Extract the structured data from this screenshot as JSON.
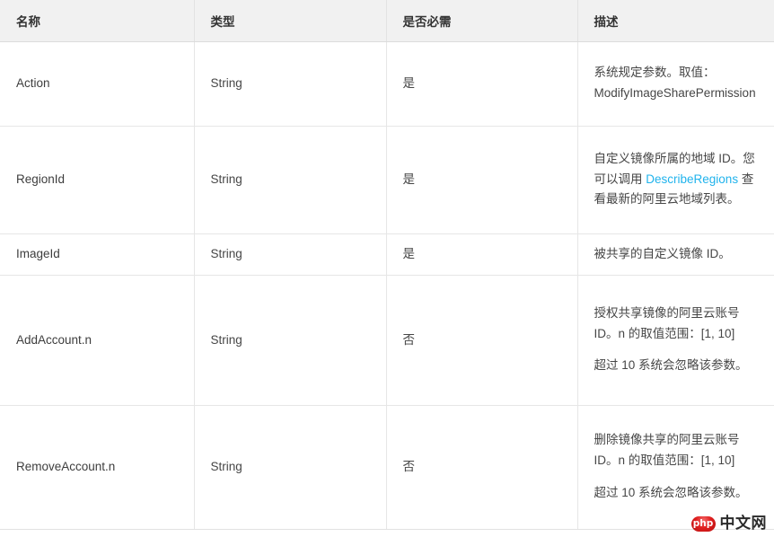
{
  "table": {
    "columns": [
      {
        "key": "name",
        "label": "名称"
      },
      {
        "key": "type",
        "label": "类型"
      },
      {
        "key": "required",
        "label": "是否必需"
      },
      {
        "key": "description",
        "label": "描述"
      }
    ],
    "rows": [
      {
        "name": "Action",
        "type": "String",
        "required": "是",
        "desc_parts": [
          {
            "text": "系统规定参数。取值：ModifyImageSharePermission"
          }
        ]
      },
      {
        "name": "RegionId",
        "type": "String",
        "required": "是",
        "desc_parts": [
          {
            "text_before": "自定义镜像所属的地域 ID。您可以调用 ",
            "link": "DescribeRegions",
            "text_after": " 查看最新的阿里云地域列表。"
          }
        ]
      },
      {
        "name": "ImageId",
        "type": "String",
        "required": "是",
        "desc_parts": [
          {
            "text": "被共享的自定义镜像 ID。"
          }
        ]
      },
      {
        "name": "AddAccount.n",
        "type": "String",
        "required": "否",
        "desc_parts": [
          {
            "text": "授权共享镜像的阿里云账号 ID。n 的取值范围：[1, 10]"
          },
          {
            "text": "超过 10 系统会忽略该参数。"
          }
        ]
      },
      {
        "name": "RemoveAccount.n",
        "type": "String",
        "required": "否",
        "desc_parts": [
          {
            "text": "删除镜像共享的阿里云账号 ID。n 的取值范围：[1, 10]"
          },
          {
            "text": "超过 10 系统会忽略该参数。"
          }
        ]
      }
    ]
  },
  "watermark": {
    "badge": "php",
    "text": "中文网"
  },
  "colors": {
    "link": "#20b3ec",
    "header_bg": "#f1f1f1",
    "border": "#e6e6e6",
    "text": "#464646",
    "watermark_badge": "#e02020"
  }
}
